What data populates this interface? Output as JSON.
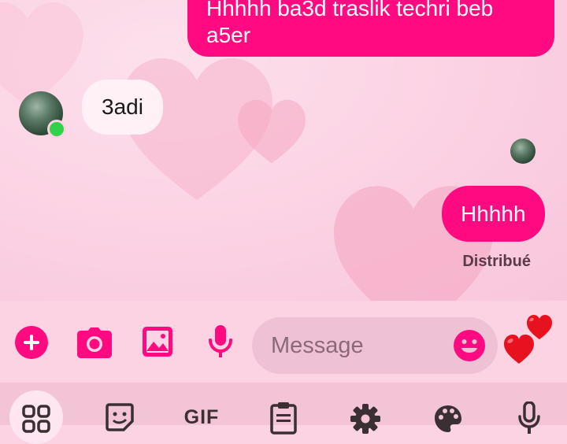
{
  "colors": {
    "accent": "#ff0a80",
    "background": "#fbd3e3",
    "incoming_bubble": "#fff1f5",
    "online": "#31d24a"
  },
  "messages": [
    {
      "direction": "outgoing",
      "text": "Hhhhh ba3d traslik techri beb\na5er"
    },
    {
      "direction": "incoming",
      "text": "3adi"
    },
    {
      "direction": "outgoing",
      "text": "Hhhhh"
    }
  ],
  "status_text": "Distribué",
  "composer": {
    "placeholder": "Message",
    "icons": [
      "plus-circle-icon",
      "camera-icon",
      "image-icon",
      "microphone-icon",
      "emoji-icon",
      "hearts-icon"
    ]
  },
  "keyboard_toolbar": {
    "items": [
      "apps-grid-icon",
      "sticker-icon",
      "gif-icon",
      "clipboard-icon",
      "settings-gear-icon",
      "palette-icon",
      "microphone-icon"
    ],
    "gif_label": "GIF"
  }
}
